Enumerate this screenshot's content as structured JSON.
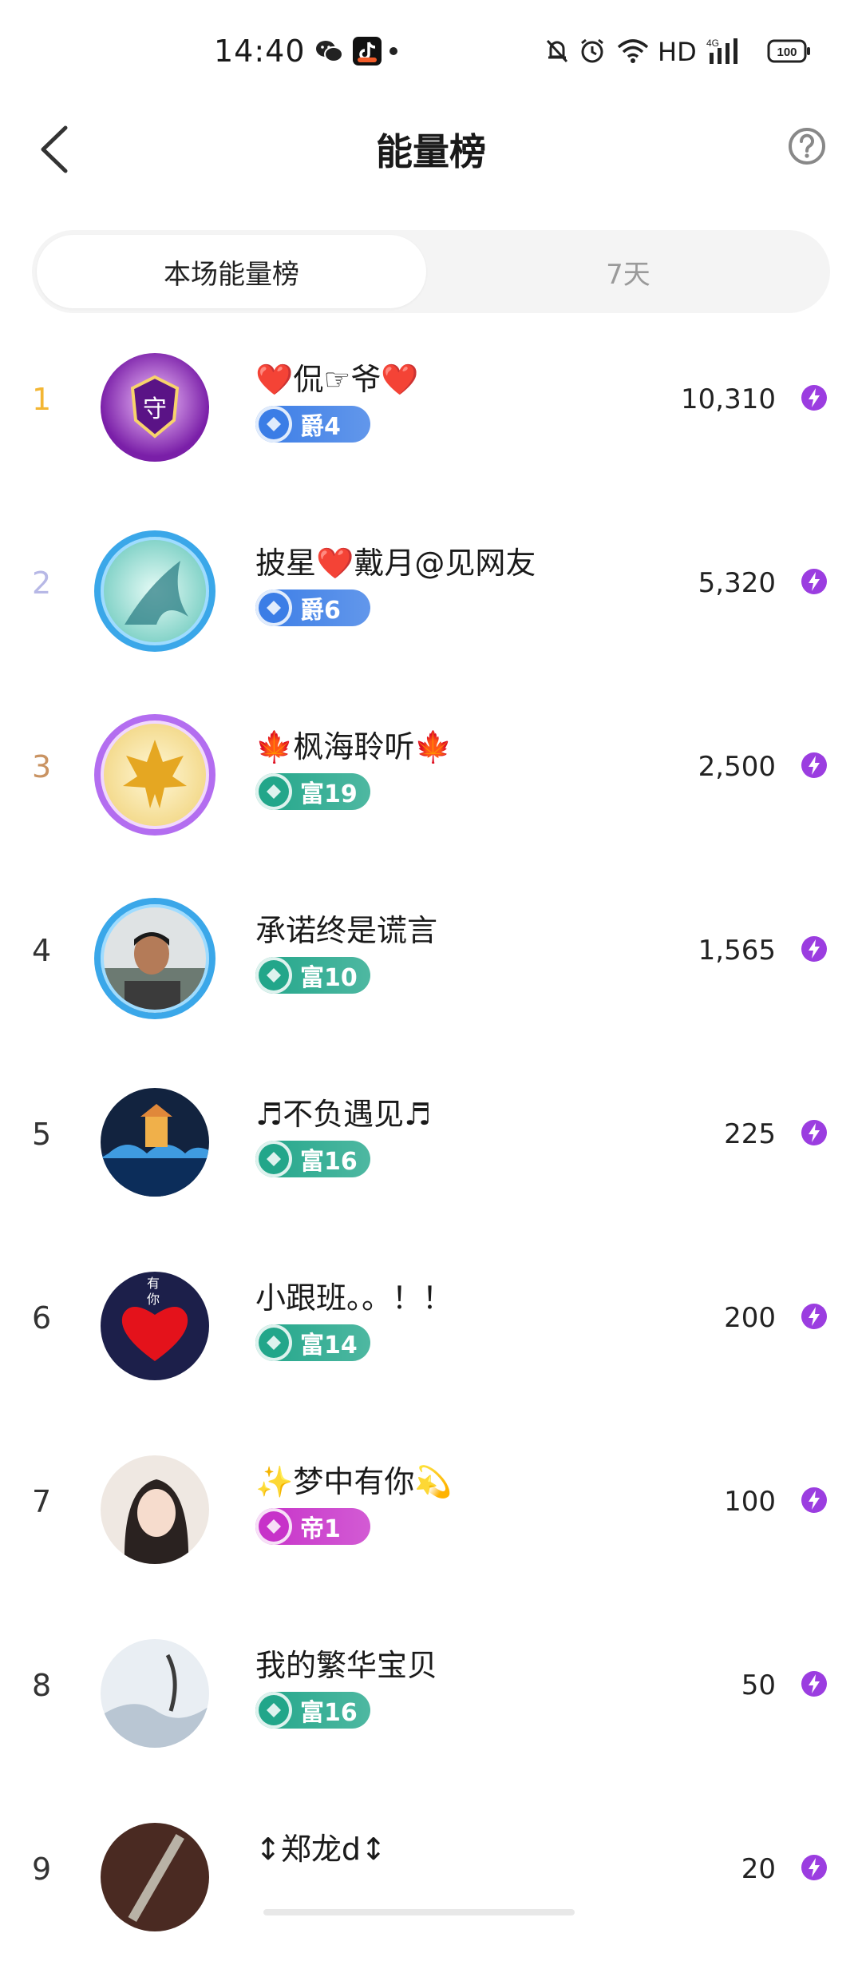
{
  "status_bar": {
    "time": "14:40",
    "network_label": "HD",
    "signal_label": "4G",
    "battery": "100",
    "icons": [
      "wechat-icon",
      "tiktok-icon",
      "dot-icon",
      "mute-bell-icon",
      "alarm-icon",
      "wifi-icon",
      "signal-icon",
      "battery-icon"
    ]
  },
  "header": {
    "title": "能量榜",
    "back_icon": "chevron-left-icon",
    "help_icon": "question-circle-icon"
  },
  "tabs": [
    {
      "label": "本场能量榜",
      "active": true
    },
    {
      "label": "7天",
      "active": false
    }
  ],
  "colors": {
    "rank1": "#f3b633",
    "rank2": "#b7b8e6",
    "rank3": "#c99362",
    "badge_jue": "#3b7de6",
    "badge_fu": "#22a68a",
    "badge_di": "#c732c9",
    "energy": "#9b3de0"
  },
  "ranking": [
    {
      "rank": "1",
      "name": "❤️侃☞爷❤️",
      "badge": "爵4",
      "badge_type": "jue",
      "score": "10,310",
      "avatar": "guard-shield-avatar",
      "frame": "none"
    },
    {
      "rank": "2",
      "name": "披星❤️戴月@见网友",
      "badge": "爵6",
      "badge_type": "jue",
      "score": "5,320",
      "avatar": "dragon-avatar",
      "frame": "blue-star-frame"
    },
    {
      "rank": "3",
      "name": "🍁枫海聆听🍁",
      "badge": "富19",
      "badge_type": "fu",
      "score": "2,500",
      "avatar": "maple-leaf-avatar",
      "frame": "purple-wing-frame"
    },
    {
      "rank": "4",
      "name": "承诺终是谎言",
      "badge": "富10",
      "badge_type": "fu",
      "score": "1,565",
      "avatar": "man-photo-avatar",
      "frame": "blue-star-frame"
    },
    {
      "rank": "5",
      "name": "♬不负遇见♬",
      "badge": "富16",
      "badge_type": "fu",
      "score": "225",
      "avatar": "night-bridge-avatar",
      "frame": "none"
    },
    {
      "rank": "6",
      "name": "小跟班。。！！",
      "badge": "富14",
      "badge_type": "fu",
      "score": "200",
      "avatar": "heart-avatar",
      "frame": "none"
    },
    {
      "rank": "7",
      "name": "✨梦中有你💫",
      "badge": "帝1",
      "badge_type": "di",
      "score": "100",
      "avatar": "woman-photo-avatar",
      "frame": "none"
    },
    {
      "rank": "8",
      "name": "我的繁华宝贝",
      "badge": "富16",
      "badge_type": "fu",
      "score": "50",
      "avatar": "ink-art-avatar",
      "frame": "none"
    },
    {
      "rank": "9",
      "name": "↕郑龙d↕",
      "badge": "",
      "badge_type": "fu",
      "score": "20",
      "avatar": "dagger-avatar",
      "frame": "none"
    }
  ]
}
